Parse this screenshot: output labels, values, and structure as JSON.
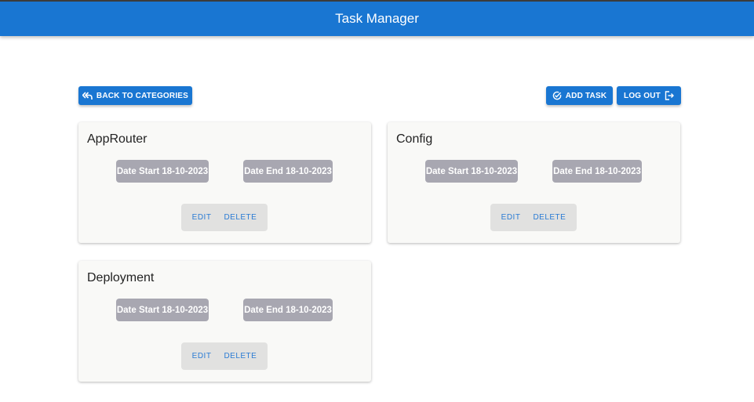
{
  "appbar": {
    "title": "Task Manager"
  },
  "toolbar": {
    "back_label": "BACK TO CATEGORIES",
    "add_label": "ADD TASK",
    "logout_label": "LOG OUT"
  },
  "colors": {
    "primary": "#1976d2",
    "chip": "#a8a7b1",
    "card": "#f9f9f7",
    "actions_bg": "#e1e1e0"
  },
  "tasks": [
    {
      "title": "AppRouter",
      "date_start": "Date Start 18-10-2023",
      "date_end": "Date End 18-10-2023",
      "edit_label": "EDIT",
      "delete_label": "DELETE"
    },
    {
      "title": "Config",
      "date_start": "Date Start 18-10-2023",
      "date_end": "Date End 18-10-2023",
      "edit_label": "EDIT",
      "delete_label": "DELETE"
    },
    {
      "title": "Deployment",
      "date_start": "Date Start 18-10-2023",
      "date_end": "Date End 18-10-2023",
      "edit_label": "EDIT",
      "delete_label": "DELETE"
    }
  ]
}
